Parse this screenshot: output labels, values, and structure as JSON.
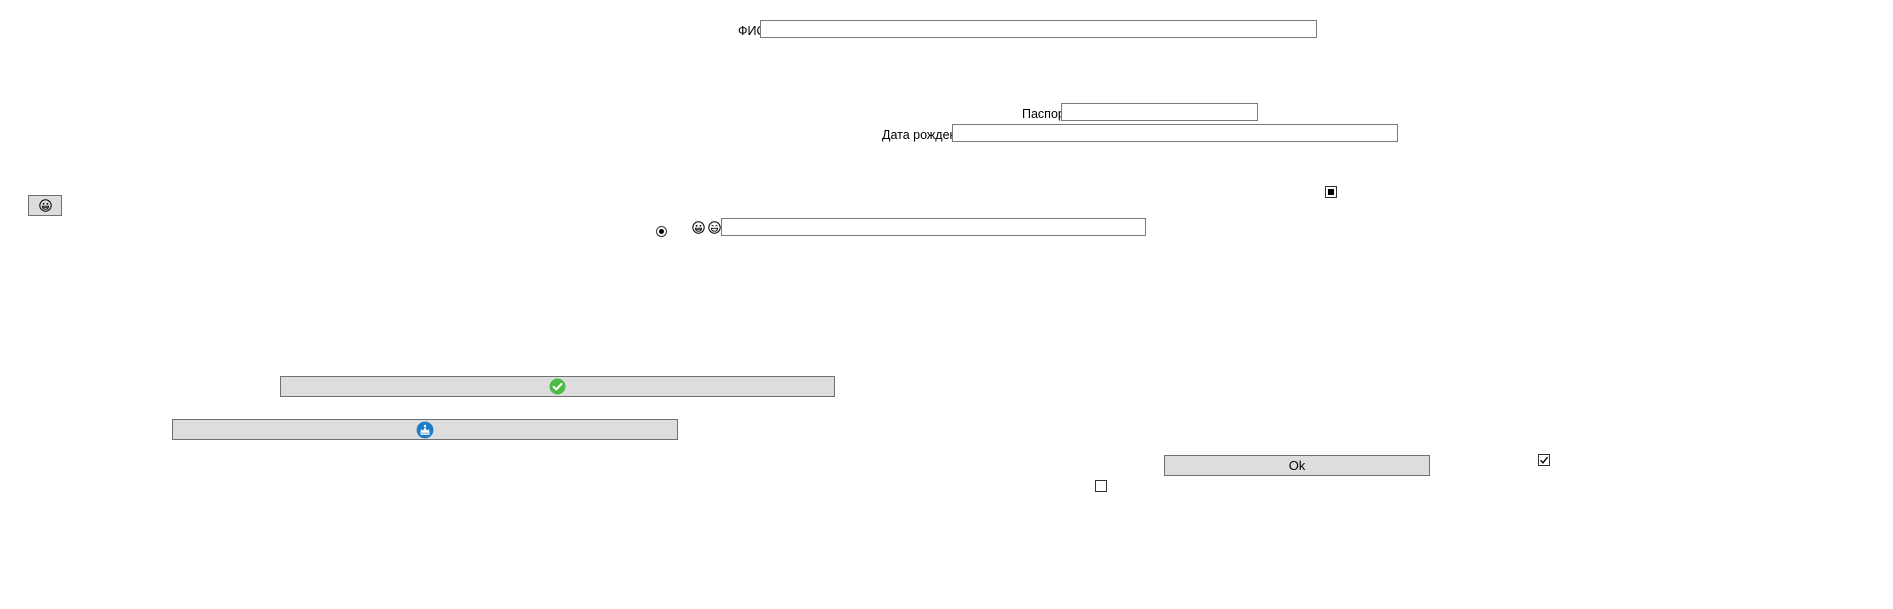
{
  "form": {
    "fio_label": "ФИО",
    "passport_label": "Паспорт",
    "birthdate_label": "Дата рождения",
    "fio_value": "",
    "passport_value": "",
    "birthdate_value": "",
    "search_value": ""
  },
  "buttons": {
    "ok_label": "Ok"
  },
  "icons": {
    "small_button_icon": "grinning-face-icon",
    "face1": "grinning-face-icon",
    "face2": "smiling-face-icon",
    "check_circle": "green-check-circle-icon",
    "blue_badge": "blue-circle-badge-icon"
  },
  "controls": {
    "indeterminate_checkbox": "indeterminate",
    "radio_selected": true,
    "checkbox_checked": true,
    "checkbox_unchecked": false
  },
  "colors": {
    "button_bg": "#dddddd",
    "green_check": "#4cbb47",
    "blue_badge": "#1f7cc7"
  }
}
